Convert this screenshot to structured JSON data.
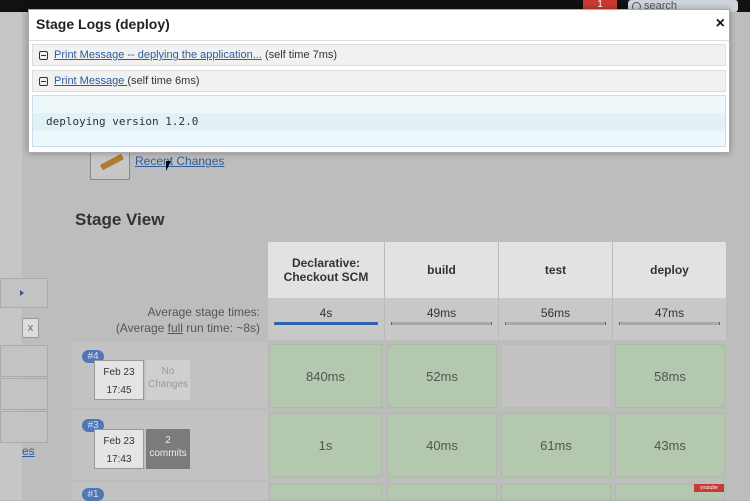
{
  "topbar": {
    "notification_count": "1",
    "search_placeholder": "search"
  },
  "recent_changes": {
    "label": "Recent Changes"
  },
  "stage_view": {
    "title": "Stage View",
    "stages": [
      {
        "name": "Declarative: Checkout SCM",
        "avg": "4s",
        "progress": 100
      },
      {
        "name": "build",
        "avg": "49ms",
        "progress": 0
      },
      {
        "name": "test",
        "avg": "56ms",
        "progress": 0
      },
      {
        "name": "deploy",
        "avg": "47ms",
        "progress": 0
      }
    ],
    "avg_label_line1": "Average stage times:",
    "avg_label_line2_pre": "(Average ",
    "avg_label_line2_u": "full",
    "avg_label_line2_post": " run time: ~8s)",
    "runs": [
      {
        "id": "#4",
        "date": "Feb 23",
        "time": "17:45",
        "changes_line1": "No",
        "changes_line2": "Changes",
        "cells": [
          "840ms",
          "52ms",
          "",
          "58ms"
        ]
      },
      {
        "id": "#3",
        "date": "Feb 23",
        "time": "17:43",
        "changes_line1": "2",
        "changes_line2": "commits",
        "cells": [
          "1s",
          "40ms",
          "61ms",
          "43ms"
        ]
      },
      {
        "id": "#1"
      }
    ]
  },
  "sidebar": {
    "partial_link": "es",
    "close_x": "x"
  },
  "modal": {
    "title": "Stage Logs (deploy)",
    "close_label": "×",
    "logs": [
      {
        "link": "Print Message -- deplying the application...",
        "suffix": " (self time 7ms)"
      },
      {
        "link": "Print Message ",
        "suffix": "(self time 6ms)"
      }
    ],
    "console_line": "deploying version 1.2.0"
  },
  "watermark": "youtube"
}
